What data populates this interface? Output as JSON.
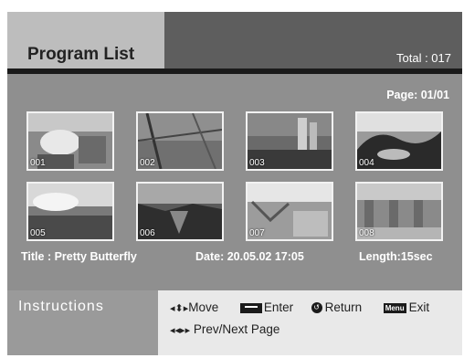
{
  "header": {
    "title": "Program List",
    "total": "Total : 017"
  },
  "page_indicator": "Page: 01/01",
  "thumbnails": [
    {
      "number": "001"
    },
    {
      "number": "002"
    },
    {
      "number": "003"
    },
    {
      "number": "004"
    },
    {
      "number": "005"
    },
    {
      "number": "006"
    },
    {
      "number": "007"
    },
    {
      "number": "008"
    }
  ],
  "info": {
    "title": "Title : Pretty Butterfly",
    "date": "Date: 20.05.02 17:05",
    "length": "Length:15sec"
  },
  "instructions": {
    "label": "Instructions",
    "move": "Move",
    "enter": "Enter",
    "return": "Return",
    "menu_key": "Menu",
    "exit": "Exit",
    "prev_next": "Prev/Next Page",
    "move_glyph": "◂⬍▸",
    "return_glyph": "↺",
    "prev_next_glyph": "◂◂▸▸"
  }
}
